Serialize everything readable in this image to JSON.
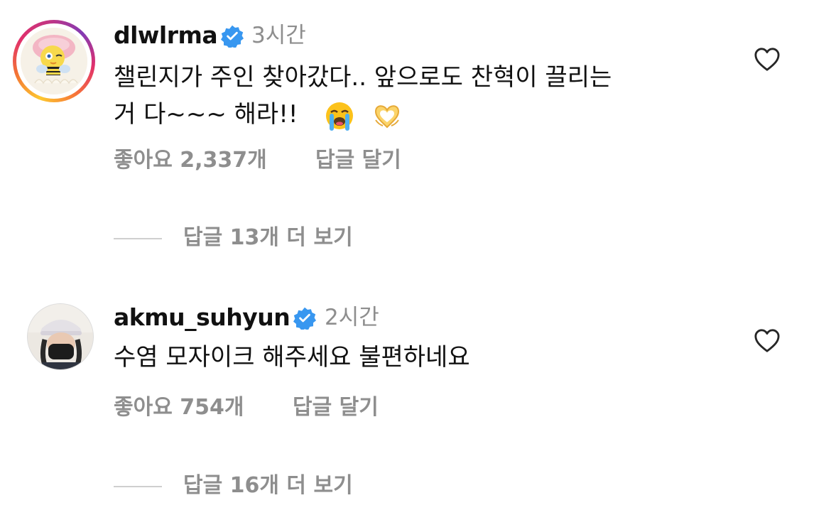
{
  "comments": [
    {
      "username": "dlwlrma",
      "time": "3시간",
      "text_line1": "챌린지가 주인 찾아갔다.. 앞으로도 찬혁이 끌리는",
      "text_line2": "거 다~~~ 해라!!",
      "emoji": [
        "loudly-crying-face",
        "heart-hands"
      ],
      "likes": "좋아요 2,337개",
      "reply": "답글 달기",
      "view_replies": "답글 13개 더 보기"
    },
    {
      "username": "akmu_suhyun",
      "time": "2시간",
      "text_line1": "수염 모자이크 해주세요 불편하네요",
      "likes": "좋아요 754개",
      "reply": "답글 달기",
      "view_replies": "답글 16개 더 보기"
    }
  ],
  "colors": {
    "verified": "#3897f0",
    "secondary_text": "#8e8e8e",
    "primary_text": "#111111",
    "divider": "#cfcfcf"
  }
}
